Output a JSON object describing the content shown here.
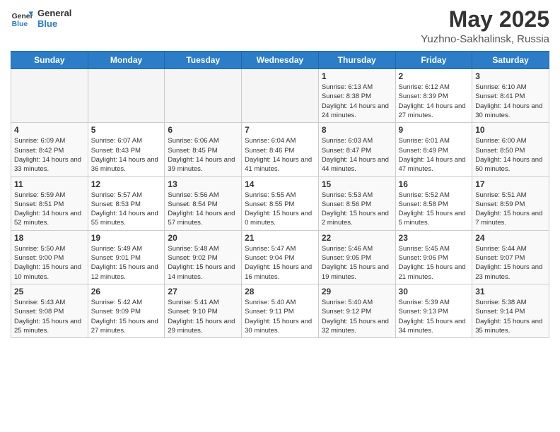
{
  "header": {
    "logo_line1": "General",
    "logo_line2": "Blue",
    "title": "May 2025",
    "subtitle": "Yuzhno-Sakhalinsk, Russia"
  },
  "days_of_week": [
    "Sunday",
    "Monday",
    "Tuesday",
    "Wednesday",
    "Thursday",
    "Friday",
    "Saturday"
  ],
  "weeks": [
    [
      {
        "day": "",
        "empty": true
      },
      {
        "day": "",
        "empty": true
      },
      {
        "day": "",
        "empty": true
      },
      {
        "day": "",
        "empty": true
      },
      {
        "day": "1",
        "sunrise": "6:13 AM",
        "sunset": "8:38 PM",
        "daylight": "14 hours and 24 minutes."
      },
      {
        "day": "2",
        "sunrise": "6:12 AM",
        "sunset": "8:39 PM",
        "daylight": "14 hours and 27 minutes."
      },
      {
        "day": "3",
        "sunrise": "6:10 AM",
        "sunset": "8:41 PM",
        "daylight": "14 hours and 30 minutes."
      }
    ],
    [
      {
        "day": "4",
        "sunrise": "6:09 AM",
        "sunset": "8:42 PM",
        "daylight": "14 hours and 33 minutes."
      },
      {
        "day": "5",
        "sunrise": "6:07 AM",
        "sunset": "8:43 PM",
        "daylight": "14 hours and 36 minutes."
      },
      {
        "day": "6",
        "sunrise": "6:06 AM",
        "sunset": "8:45 PM",
        "daylight": "14 hours and 39 minutes."
      },
      {
        "day": "7",
        "sunrise": "6:04 AM",
        "sunset": "8:46 PM",
        "daylight": "14 hours and 41 minutes."
      },
      {
        "day": "8",
        "sunrise": "6:03 AM",
        "sunset": "8:47 PM",
        "daylight": "14 hours and 44 minutes."
      },
      {
        "day": "9",
        "sunrise": "6:01 AM",
        "sunset": "8:49 PM",
        "daylight": "14 hours and 47 minutes."
      },
      {
        "day": "10",
        "sunrise": "6:00 AM",
        "sunset": "8:50 PM",
        "daylight": "14 hours and 50 minutes."
      }
    ],
    [
      {
        "day": "11",
        "sunrise": "5:59 AM",
        "sunset": "8:51 PM",
        "daylight": "14 hours and 52 minutes."
      },
      {
        "day": "12",
        "sunrise": "5:57 AM",
        "sunset": "8:53 PM",
        "daylight": "14 hours and 55 minutes."
      },
      {
        "day": "13",
        "sunrise": "5:56 AM",
        "sunset": "8:54 PM",
        "daylight": "14 hours and 57 minutes."
      },
      {
        "day": "14",
        "sunrise": "5:55 AM",
        "sunset": "8:55 PM",
        "daylight": "15 hours and 0 minutes."
      },
      {
        "day": "15",
        "sunrise": "5:53 AM",
        "sunset": "8:56 PM",
        "daylight": "15 hours and 2 minutes."
      },
      {
        "day": "16",
        "sunrise": "5:52 AM",
        "sunset": "8:58 PM",
        "daylight": "15 hours and 5 minutes."
      },
      {
        "day": "17",
        "sunrise": "5:51 AM",
        "sunset": "8:59 PM",
        "daylight": "15 hours and 7 minutes."
      }
    ],
    [
      {
        "day": "18",
        "sunrise": "5:50 AM",
        "sunset": "9:00 PM",
        "daylight": "15 hours and 10 minutes."
      },
      {
        "day": "19",
        "sunrise": "5:49 AM",
        "sunset": "9:01 PM",
        "daylight": "15 hours and 12 minutes."
      },
      {
        "day": "20",
        "sunrise": "5:48 AM",
        "sunset": "9:02 PM",
        "daylight": "15 hours and 14 minutes."
      },
      {
        "day": "21",
        "sunrise": "5:47 AM",
        "sunset": "9:04 PM",
        "daylight": "15 hours and 16 minutes."
      },
      {
        "day": "22",
        "sunrise": "5:46 AM",
        "sunset": "9:05 PM",
        "daylight": "15 hours and 19 minutes."
      },
      {
        "day": "23",
        "sunrise": "5:45 AM",
        "sunset": "9:06 PM",
        "daylight": "15 hours and 21 minutes."
      },
      {
        "day": "24",
        "sunrise": "5:44 AM",
        "sunset": "9:07 PM",
        "daylight": "15 hours and 23 minutes."
      }
    ],
    [
      {
        "day": "25",
        "sunrise": "5:43 AM",
        "sunset": "9:08 PM",
        "daylight": "15 hours and 25 minutes."
      },
      {
        "day": "26",
        "sunrise": "5:42 AM",
        "sunset": "9:09 PM",
        "daylight": "15 hours and 27 minutes."
      },
      {
        "day": "27",
        "sunrise": "5:41 AM",
        "sunset": "9:10 PM",
        "daylight": "15 hours and 29 minutes."
      },
      {
        "day": "28",
        "sunrise": "5:40 AM",
        "sunset": "9:11 PM",
        "daylight": "15 hours and 30 minutes."
      },
      {
        "day": "29",
        "sunrise": "5:40 AM",
        "sunset": "9:12 PM",
        "daylight": "15 hours and 32 minutes."
      },
      {
        "day": "30",
        "sunrise": "5:39 AM",
        "sunset": "9:13 PM",
        "daylight": "15 hours and 34 minutes."
      },
      {
        "day": "31",
        "sunrise": "5:38 AM",
        "sunset": "9:14 PM",
        "daylight": "15 hours and 35 minutes."
      }
    ]
  ]
}
